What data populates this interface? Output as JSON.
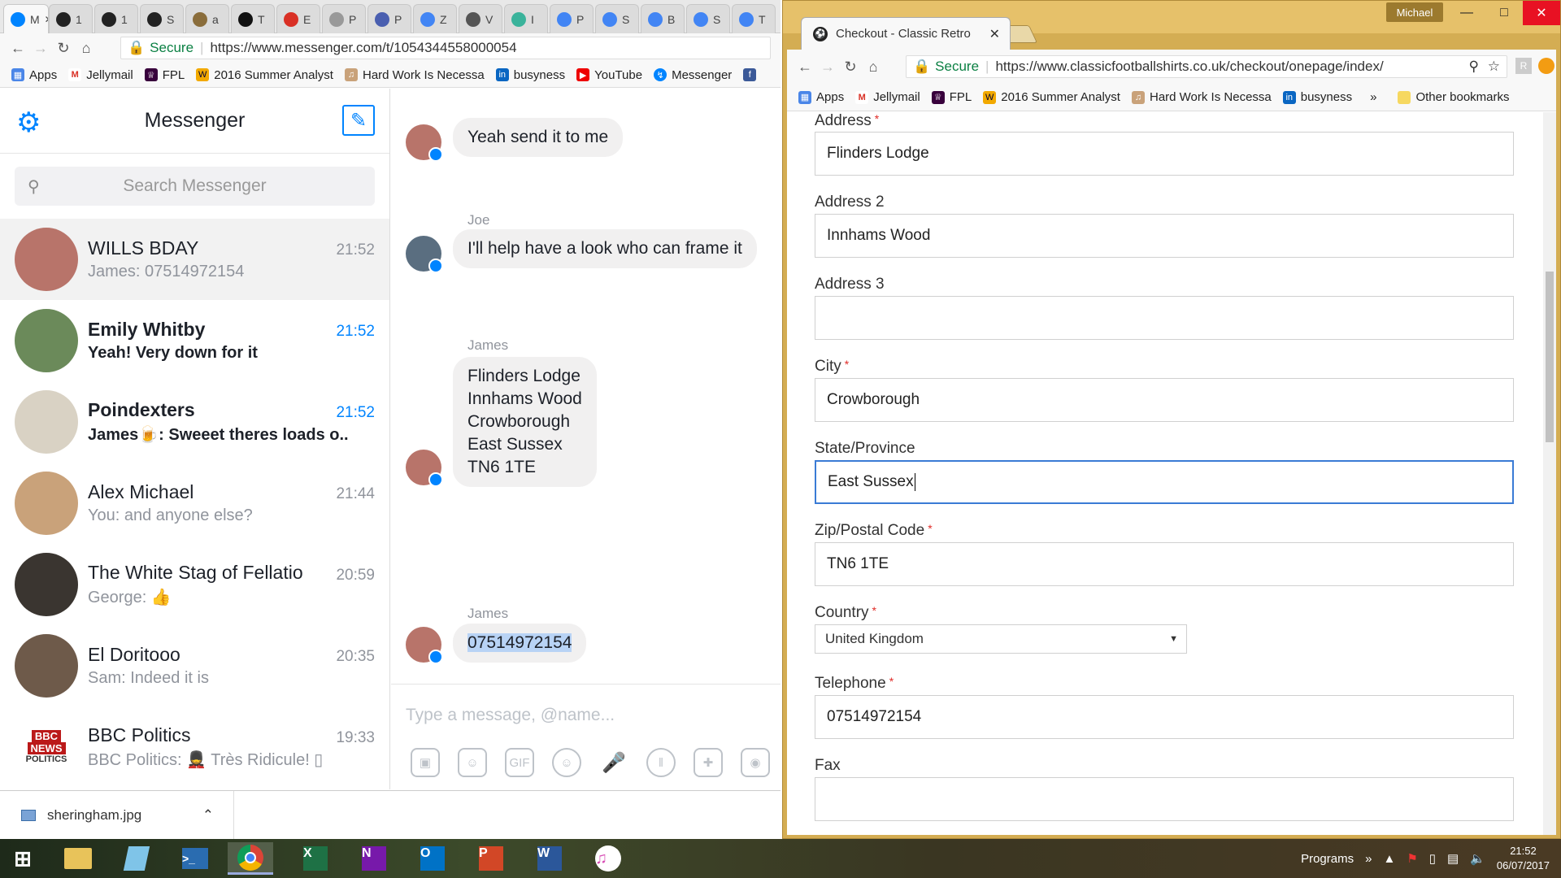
{
  "left_browser": {
    "tabs": [
      {
        "label": "M",
        "icon": "messenger-favicon",
        "active": true
      },
      {
        "label": "1",
        "icon": "football-favicon"
      },
      {
        "label": "1",
        "icon": "football-favicon"
      },
      {
        "label": "S",
        "icon": "football-favicon"
      },
      {
        "label": "a",
        "icon": "badge-favicon"
      },
      {
        "label": "T",
        "icon": "w-favicon"
      },
      {
        "label": "E",
        "icon": "gmail-favicon"
      },
      {
        "label": "P",
        "icon": "doc-favicon"
      },
      {
        "label": "P",
        "icon": "s-favicon"
      },
      {
        "label": "Z",
        "icon": "google-favicon"
      },
      {
        "label": "V",
        "icon": "film-favicon"
      },
      {
        "label": "I",
        "icon": "r-favicon"
      },
      {
        "label": "P",
        "icon": "google-favicon"
      },
      {
        "label": "S",
        "icon": "google-favicon"
      },
      {
        "label": "B",
        "icon": "google-favicon"
      },
      {
        "label": "S",
        "icon": "google-favicon"
      },
      {
        "label": "T",
        "icon": "google-favicon"
      }
    ],
    "secure_label": "Secure",
    "url": "https://www.messenger.com/t/1054344558000054",
    "bookmarks": [
      "Apps",
      "Jellymail",
      "FPL",
      "2016 Summer Analyst",
      "Hard Work Is Necessa",
      "busyness",
      "YouTube",
      "Messenger"
    ]
  },
  "messenger": {
    "title": "Messenger",
    "search_placeholder": "Search Messenger",
    "conversations": [
      {
        "name": "WILLS BDAY",
        "preview": "James: 07514972154",
        "time": "21:52",
        "selected": true,
        "unread": false,
        "avatar_color": "#b8746a"
      },
      {
        "name": "Emily Whitby",
        "preview": "Yeah! Very down for it",
        "time": "21:52",
        "selected": false,
        "unread": true,
        "avatar_color": "#6b8a5a"
      },
      {
        "name": "Poindexters",
        "preview": "James🍺: Sweeet theres loads o..",
        "time": "21:52",
        "selected": false,
        "unread": true,
        "avatar_color": "#d9d2c4"
      },
      {
        "name": "Alex Michael",
        "preview": "You: and anyone else?",
        "time": "21:44",
        "selected": false,
        "unread": false,
        "avatar_color": "#c9a27a"
      },
      {
        "name": "The White Stag of Fellatio",
        "preview": "George: 👍",
        "time": "20:59",
        "selected": false,
        "unread": false,
        "avatar_color": "#3a3530"
      },
      {
        "name": "El Doritooo",
        "preview": "Sam: Indeed it is",
        "time": "20:35",
        "selected": false,
        "unread": false,
        "avatar_color": "#6e5a4a"
      },
      {
        "name": "BBC Politics",
        "preview": "BBC Politics: 💂 Très Ridicule! ▯",
        "time": "19:33",
        "selected": false,
        "unread": false,
        "avatar_color": "#bb1919"
      }
    ],
    "bbc_logo_text": [
      "BBC",
      "NEWS",
      "POLITICS"
    ],
    "messages": {
      "m1": "Yeah send it to me",
      "joe_sender": "Joe",
      "m2": "I'll help have a look who can frame it",
      "james_sender": "James",
      "address_lines": [
        "Flinders Lodge",
        "Innhams Wood",
        "Crowborough",
        "East Sussex",
        "TN6 1TE"
      ],
      "james_sender2": "James",
      "m4": "07514972154"
    },
    "composer_placeholder": "Type a message, @name...",
    "composer_tools": [
      "image-icon",
      "sticker-icon",
      "gif-icon",
      "emoji-icon",
      "microphone-icon",
      "poll-icon",
      "game-icon",
      "camera-icon"
    ],
    "gif_label": "GIF"
  },
  "downloads": {
    "file": "sheringham.jpg"
  },
  "right_browser": {
    "profile": "Michael",
    "tab_title": "Checkout - Classic Retro",
    "secure_label": "Secure",
    "url": "https://www.classicfootballshirts.co.uk/checkout/onepage/index/",
    "bookmarks": [
      "Apps",
      "Jellymail",
      "FPL",
      "2016 Summer Analyst",
      "Hard Work Is Necessa",
      "busyness"
    ],
    "overflow": "»",
    "other_bookmarks": "Other bookmarks"
  },
  "checkout_form": {
    "address_label": "Address",
    "address_value": "Flinders Lodge",
    "address2_label": "Address 2",
    "address2_value": "Innhams Wood",
    "address3_label": "Address 3",
    "address3_value": "",
    "city_label": "City",
    "city_value": "Crowborough",
    "state_label": "State/Province",
    "state_value": "East Sussex",
    "zip_label": "Zip/Postal Code",
    "zip_value": "TN6 1TE",
    "country_label": "Country",
    "country_value": "United Kingdom",
    "telephone_label": "Telephone",
    "telephone_value": "07514972154",
    "fax_label": "Fax",
    "fax_value": "",
    "required_mark": "*"
  },
  "taskbar": {
    "apps": [
      "windows-start",
      "file-explorer",
      "notepad",
      "powershell",
      "chrome",
      "excel",
      "onenote",
      "outlook",
      "powerpoint",
      "word",
      "itunes"
    ],
    "app_letters": {
      "excel": "X",
      "onenote": "N",
      "outlook": "O",
      "powerpoint": "P",
      "word": "W"
    },
    "programs_label": "Programs",
    "time": "21:52",
    "date": "06/07/2017"
  }
}
